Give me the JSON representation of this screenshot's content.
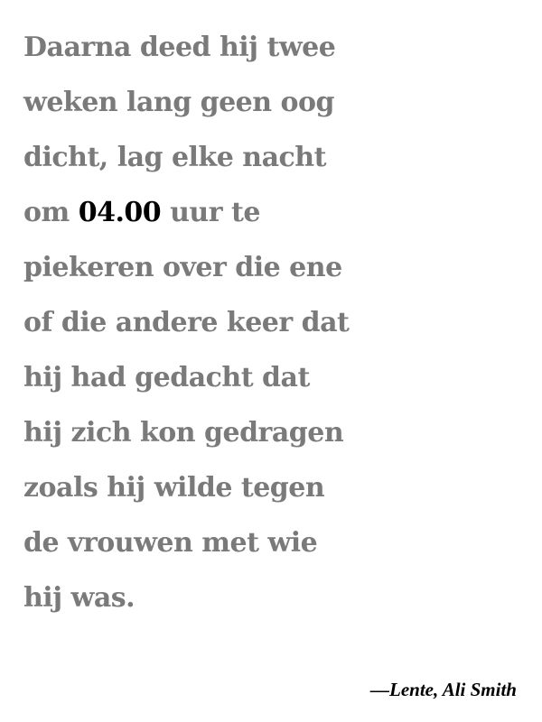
{
  "quote": {
    "line1": "Daarna deed hij twee",
    "line2": "weken lang geen oog",
    "line3": "dicht, lag elke nacht",
    "line4_before": "om ",
    "line4_highlight": "04.00",
    "line4_after": " uur te",
    "line5": "piekeren over die ene",
    "line6": "of die andere keer dat",
    "line7": "hij had gedacht dat",
    "line8": "hij zich kon gedragen",
    "line9": "zoals hij wilde tegen",
    "line10": "de vrouwen met wie",
    "line11": "hij was."
  },
  "attribution": "—Lente, Ali Smith",
  "colors": {
    "text": "#7a7a7a",
    "highlight": "#000000",
    "background": "#ffffff"
  }
}
